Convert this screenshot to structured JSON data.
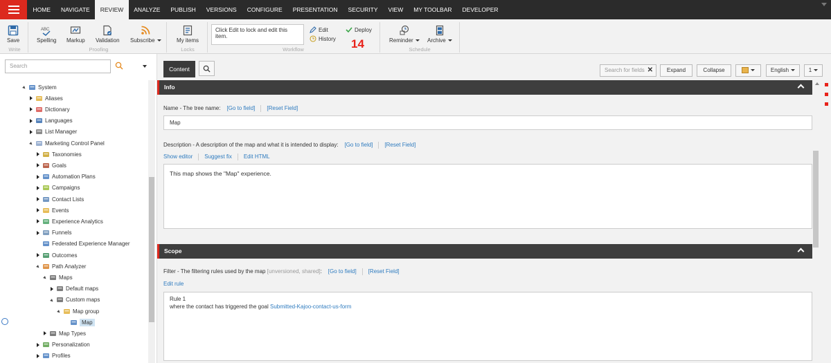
{
  "menu": {
    "tabs": [
      "HOME",
      "NAVIGATE",
      "REVIEW",
      "ANALYZE",
      "PUBLISH",
      "VERSIONS",
      "CONFIGURE",
      "PRESENTATION",
      "SECURITY",
      "VIEW",
      "MY TOOLBAR",
      "DEVELOPER"
    ],
    "active_tab": "REVIEW"
  },
  "ribbon": {
    "save": "Save",
    "write_group": "Write",
    "spelling": "Spelling",
    "markup": "Markup",
    "validation": "Validation",
    "subscribe": "Subscribe",
    "proofing_group": "Proofing",
    "my_items": "My items",
    "locks_group": "Locks",
    "lock_message": "Click Edit to lock and edit this item.",
    "edit": "Edit",
    "history": "History",
    "deploy": "Deploy",
    "workflow_group": "Workflow",
    "reminder": "Reminder",
    "archive": "Archive",
    "schedule_group": "Schedule",
    "badge": "14"
  },
  "tree": {
    "search_placeholder": "Search",
    "nodes": [
      {
        "label": "System",
        "level": 0,
        "state": "open",
        "icon": "system-icon"
      },
      {
        "label": "Aliases",
        "level": 1,
        "state": "closed",
        "icon": "aliases-icon"
      },
      {
        "label": "Dictionary",
        "level": 1,
        "state": "closed",
        "icon": "dictionary-icon"
      },
      {
        "label": "Languages",
        "level": 1,
        "state": "closed",
        "icon": "languages-icon"
      },
      {
        "label": "List Manager",
        "level": 1,
        "state": "closed",
        "icon": "list-manager-icon"
      },
      {
        "label": "Marketing Control Panel",
        "level": 1,
        "state": "open",
        "icon": "marketing-icon"
      },
      {
        "label": "Taxonomies",
        "level": 2,
        "state": "closed",
        "icon": "taxonomies-icon"
      },
      {
        "label": "Goals",
        "level": 2,
        "state": "closed",
        "icon": "goals-icon"
      },
      {
        "label": "Automation Plans",
        "level": 2,
        "state": "closed",
        "icon": "automation-icon"
      },
      {
        "label": "Campaigns",
        "level": 2,
        "state": "closed",
        "icon": "campaigns-icon"
      },
      {
        "label": "Contact Lists",
        "level": 2,
        "state": "closed",
        "icon": "contact-lists-icon"
      },
      {
        "label": "Events",
        "level": 2,
        "state": "closed",
        "icon": "events-icon"
      },
      {
        "label": "Experience Analytics",
        "level": 2,
        "state": "closed",
        "icon": "analytics-icon"
      },
      {
        "label": "Funnels",
        "level": 2,
        "state": "closed",
        "icon": "funnels-icon"
      },
      {
        "label": "Federated Experience Manager",
        "level": 2,
        "state": "none",
        "icon": "fxm-icon"
      },
      {
        "label": "Outcomes",
        "level": 2,
        "state": "closed",
        "icon": "outcomes-icon"
      },
      {
        "label": "Path Analyzer",
        "level": 2,
        "state": "open",
        "icon": "path-analyzer-icon"
      },
      {
        "label": "Maps",
        "level": 3,
        "state": "open",
        "icon": "maps-icon"
      },
      {
        "label": "Default maps",
        "level": 4,
        "state": "closed",
        "icon": "maps-icon"
      },
      {
        "label": "Custom maps",
        "level": 4,
        "state": "open",
        "icon": "maps-icon"
      },
      {
        "label": "Map group",
        "level": 5,
        "state": "open",
        "icon": "folder-icon"
      },
      {
        "label": "Map",
        "level": 6,
        "state": "none",
        "icon": "map-icon",
        "selected": true
      },
      {
        "label": "Map Types",
        "level": 3,
        "state": "closed",
        "icon": "maps-icon"
      },
      {
        "label": "Personalization",
        "level": 2,
        "state": "closed",
        "icon": "personalization-icon"
      },
      {
        "label": "Profiles",
        "level": 2,
        "state": "closed",
        "icon": "profiles-icon"
      }
    ]
  },
  "content": {
    "tab_label": "Content",
    "search_fields": "Search for fields",
    "expand": "Expand",
    "collapse": "Collapse",
    "language": "English",
    "version": "1",
    "info_section": "Info",
    "name_label": "Name - The tree name:",
    "go_to_field": "[Go to field]",
    "reset_field": "[Reset Field]",
    "name_value": "Map",
    "description_label": "Description - A description of the map and what it is intended to display:",
    "show_editor": "Show editor",
    "suggest_fix": "Suggest fix",
    "edit_html": "Edit HTML",
    "description_value": "This map shows the \"Map\" experience.",
    "scope_section": "Scope",
    "filter_label": "Filter - The filtering rules used by the map",
    "filter_meta": "[unversioned, shared]",
    "filter_colon": ":",
    "edit_rule": "Edit rule",
    "rule_title": "Rule 1",
    "rule_text": "where the contact has triggered the goal",
    "rule_goal": "Submitted-Kajoo-contact-us-form"
  },
  "colors": {
    "accent_red": "#dc291e",
    "topbar": "#2b2b2b",
    "link_blue": "#2e7bbf",
    "section_header": "#3e3e3e"
  }
}
